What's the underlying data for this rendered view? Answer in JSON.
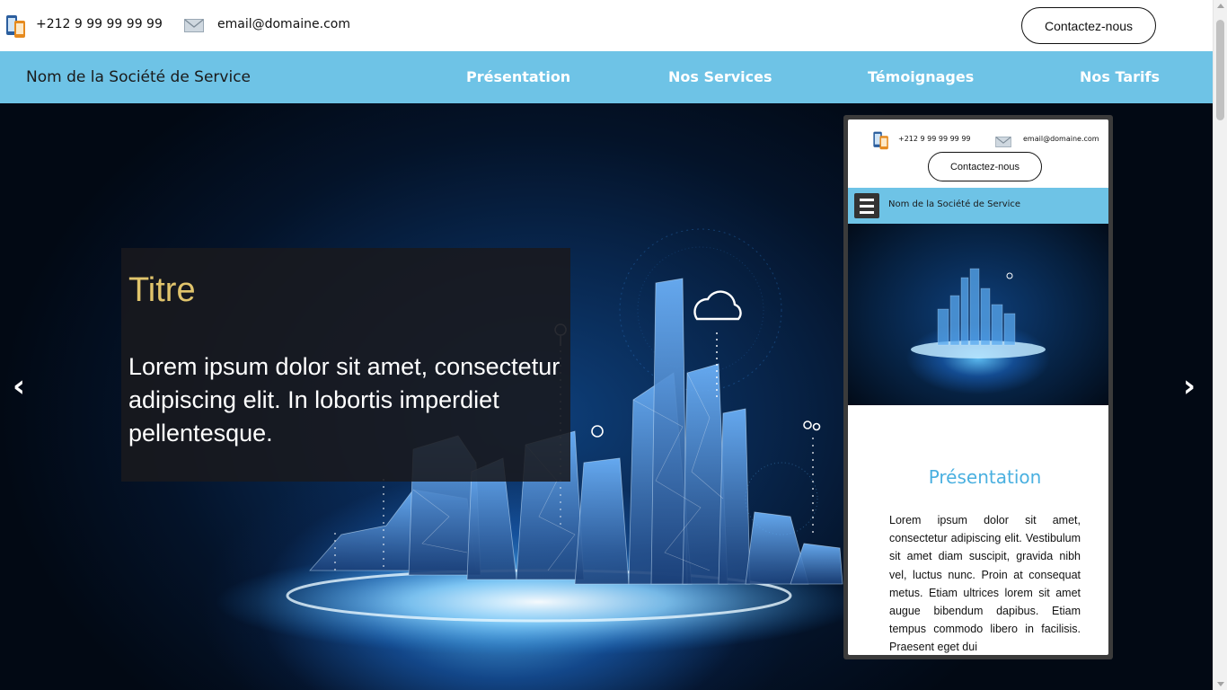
{
  "topbar": {
    "phone_icon": "phone-tablet-icon",
    "phone": "+212 9 99 99 99 99",
    "mail_icon": "envelope-icon",
    "email": "email@domaine.com",
    "contact_label": "Contactez-nous"
  },
  "navbar": {
    "brand": "Nom de la Société de Service",
    "links": [
      "Présentation",
      "Nos Services",
      "Témoignages",
      "Nos Tarifs"
    ],
    "background": "#6ec3e6"
  },
  "hero": {
    "title": "Titre",
    "text": "Lorem ipsum dolor sit amet, consectetur adipiscing elit. In lobortis imperdiet pellentesque.",
    "prev_arrow": "‹",
    "next_arrow": "›",
    "title_color": "#e0c46c"
  },
  "mobile_preview": {
    "phone": "+212 9 99 99 99 99",
    "email": "email@domaine.com",
    "contact_label": "Contactez-nous",
    "menu_icon": "hamburger-icon",
    "brand": "Nom de la Société de Service",
    "section_title": "Présentation",
    "paragraph": "Lorem ipsum dolor sit amet, consectetur adipiscing elit. Vestibulum sit amet diam suscipit, gravida nibh vel, luctus nunc. Proin at consequat metus. Etiam ultrices lorem sit amet augue bibendum dapibus. Etiam tempus commodo libero in facilisis. Praesent eget dui"
  }
}
